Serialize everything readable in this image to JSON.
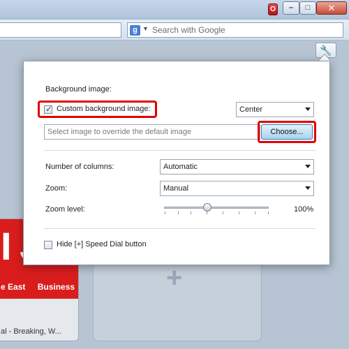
{
  "titlebar": {
    "browser_icon": "opera-icon",
    "browser_glyph": "O",
    "minimize_glyph": "–",
    "maximize_glyph": "□",
    "close_glyph": "✕"
  },
  "search": {
    "engine_letter": "g",
    "placeholder": "Search with Google"
  },
  "speed_dial": {
    "settings_glyph": "🔧",
    "tile_left": {
      "logo_text": "I J",
      "nav": [
        "e East",
        "Business"
      ],
      "caption": "al - Breaking, W..."
    },
    "add_glyph": "+"
  },
  "panel": {
    "background_heading": "Background image:",
    "custom_background_label": "Custom background image:",
    "custom_background_checked": true,
    "position_select_value": "Center",
    "image_input_placeholder": "Select image to override the default image",
    "choose_button": "Choose...",
    "columns_label": "Number of columns:",
    "columns_value": "Automatic",
    "zoom_label": "Zoom:",
    "zoom_value": "Manual",
    "zoom_level_label": "Zoom level:",
    "zoom_level_value": "100%",
    "zoom_level_fraction": 0.41,
    "hide_speed_dial_label": "Hide [+] Speed Dial button",
    "hide_speed_dial_checked": false
  },
  "colors": {
    "highlight": "#e20000",
    "accent_button": "#a7d2ef"
  }
}
